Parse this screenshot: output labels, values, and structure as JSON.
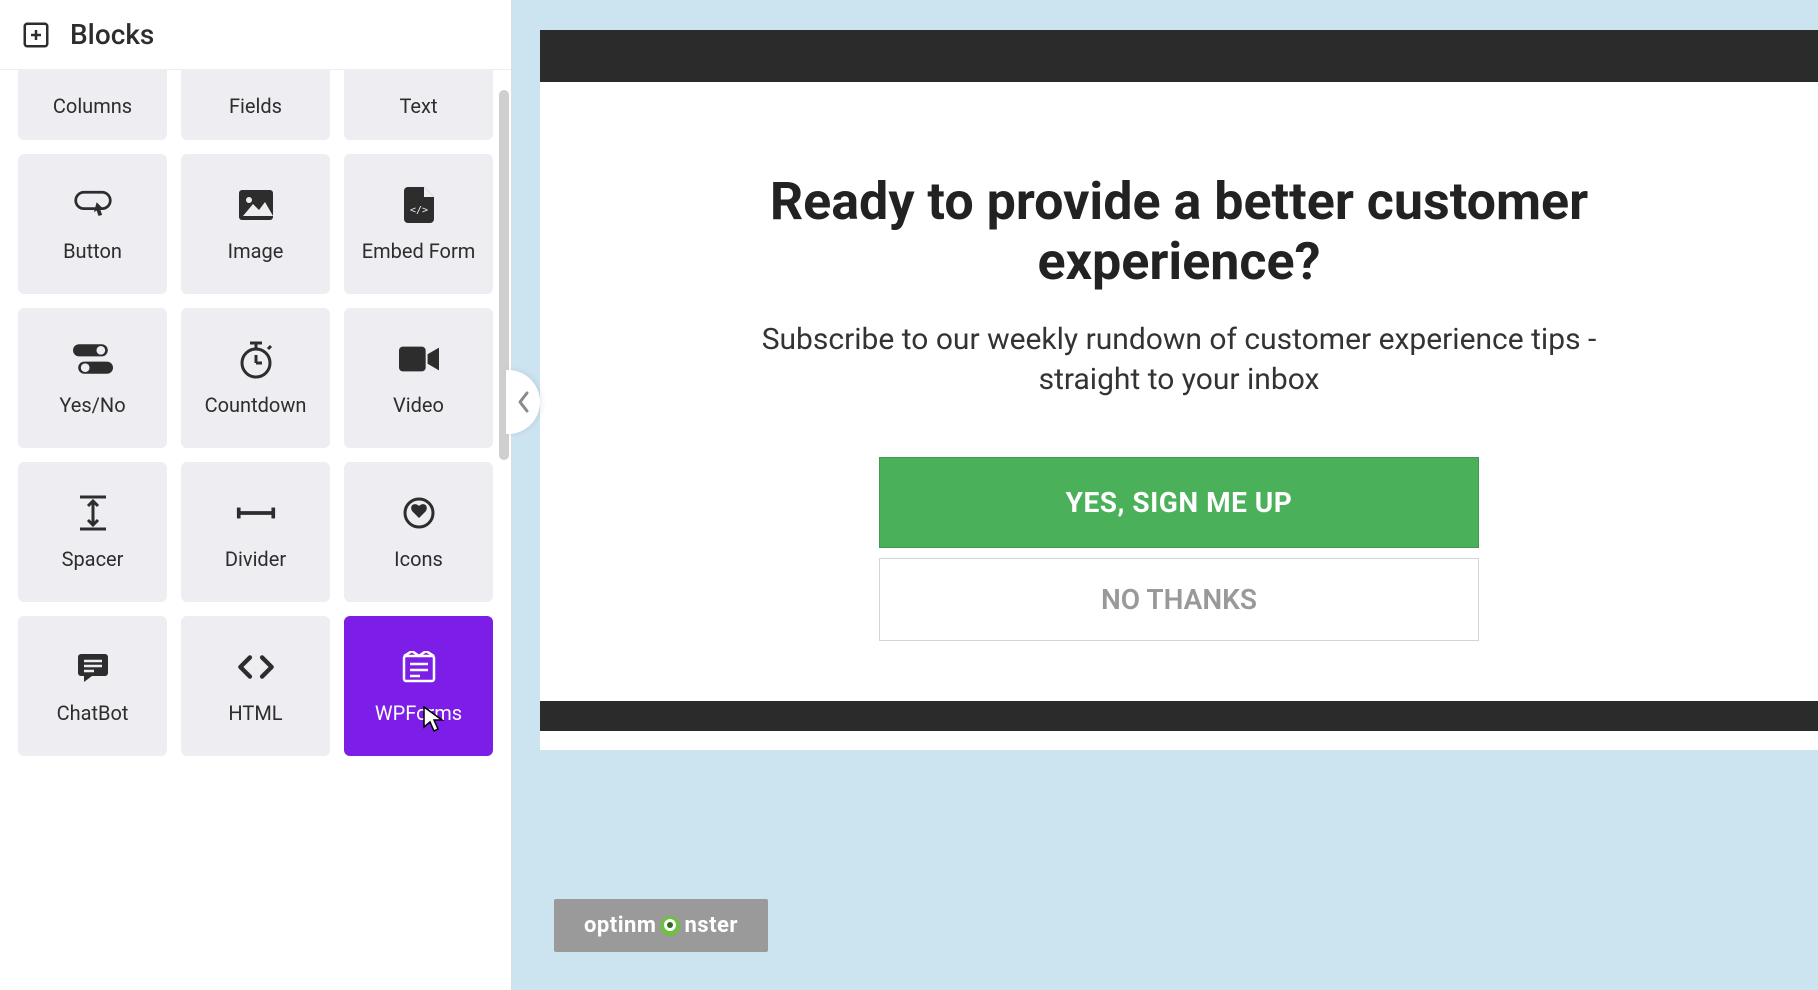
{
  "sidebar": {
    "title": "Blocks",
    "blocks": [
      {
        "label": "Columns",
        "icon": "columns-icon"
      },
      {
        "label": "Fields",
        "icon": "fields-icon"
      },
      {
        "label": "Text",
        "icon": "text-icon"
      },
      {
        "label": "Button",
        "icon": "button-icon"
      },
      {
        "label": "Image",
        "icon": "image-icon"
      },
      {
        "label": "Embed Form",
        "icon": "embed-form-icon"
      },
      {
        "label": "Yes/No",
        "icon": "yesno-icon"
      },
      {
        "label": "Countdown",
        "icon": "countdown-icon"
      },
      {
        "label": "Video",
        "icon": "video-icon"
      },
      {
        "label": "Spacer",
        "icon": "spacer-icon"
      },
      {
        "label": "Divider",
        "icon": "divider-icon"
      },
      {
        "label": "Icons",
        "icon": "icons-icon"
      },
      {
        "label": "ChatBot",
        "icon": "chatbot-icon"
      },
      {
        "label": "HTML",
        "icon": "html-icon"
      },
      {
        "label": "WPForms",
        "icon": "wpforms-icon",
        "selected": true
      }
    ]
  },
  "preview": {
    "headline": "Ready to provide a better customer experience?",
    "subtext": "Subscribe to our weekly rundown of customer experience tips - straight to your inbox",
    "primary_cta": "YES, SIGN ME UP",
    "secondary_cta": "NO THANKS",
    "brand_prefix": "optinm",
    "brand_suffix": "nster"
  },
  "colors": {
    "accent_purple": "#7c1de8",
    "cta_green": "#4bb05a",
    "canvas_bg": "#cce4f0"
  }
}
